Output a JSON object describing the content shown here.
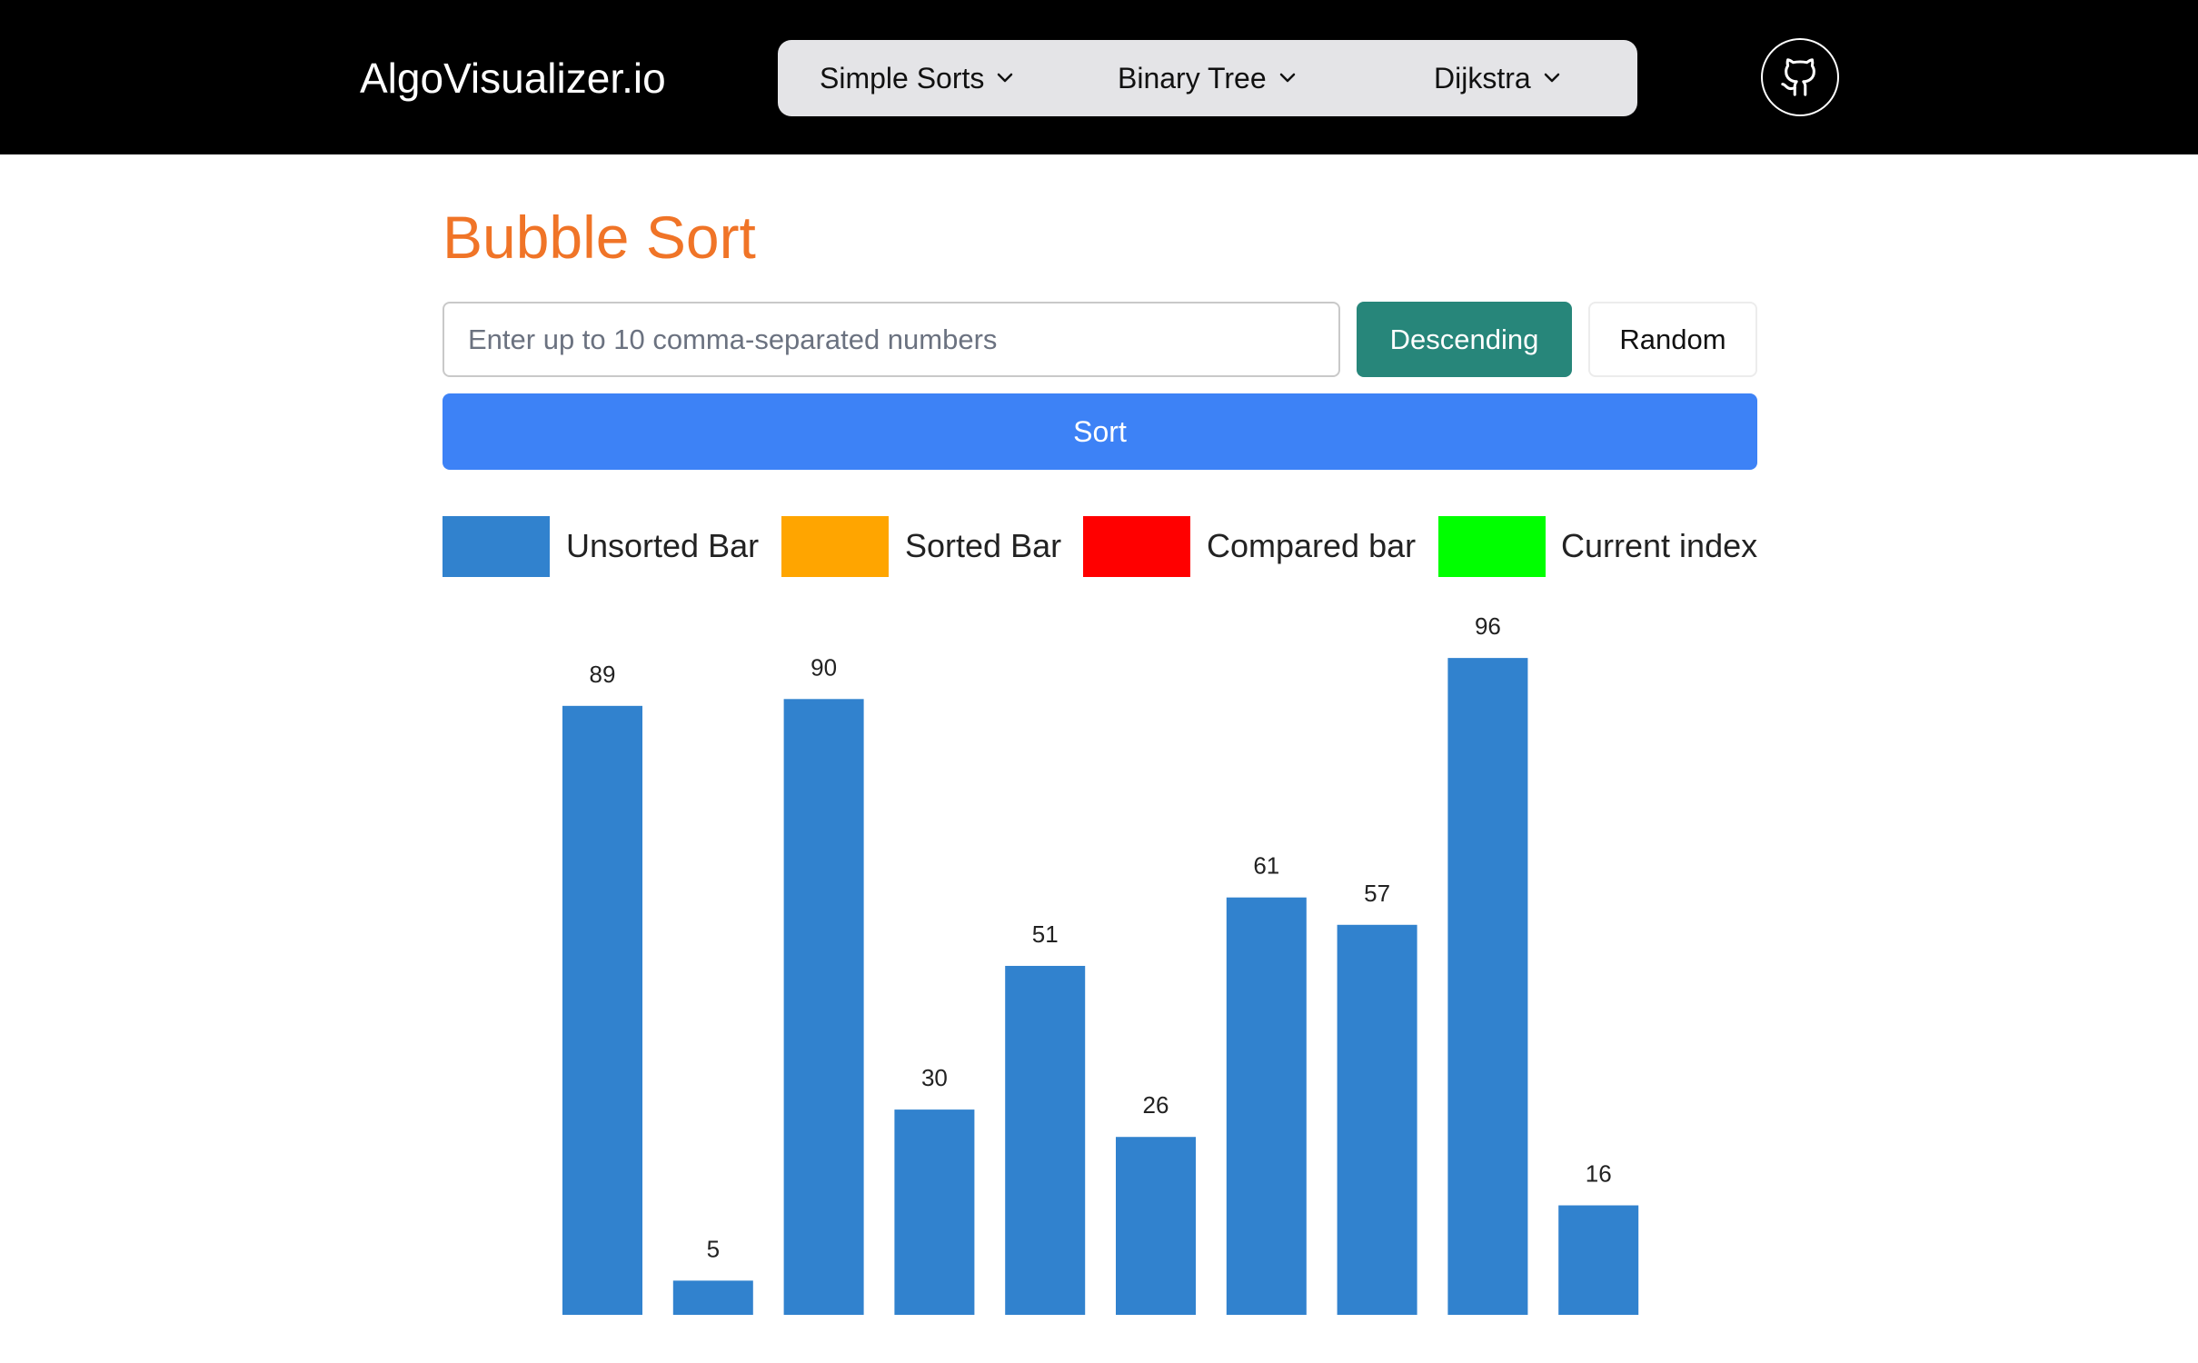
{
  "navbar": {
    "brand": "AlgoVisualizer.io",
    "menu": [
      {
        "label": "Simple Sorts"
      },
      {
        "label": "Binary Tree"
      },
      {
        "label": "Dijkstra"
      }
    ],
    "github_icon": "github-icon"
  },
  "page": {
    "title": "Bubble Sort"
  },
  "input": {
    "placeholder": "Enter up to 10 comma-separated numbers",
    "value": ""
  },
  "buttons": {
    "descending": "Descending",
    "random": "Random",
    "sort": "Sort"
  },
  "legend": [
    {
      "label": "Unsorted Bar",
      "color": "#3182ce"
    },
    {
      "label": "Sorted Bar",
      "color": "#ffa500"
    },
    {
      "label": "Compared bar",
      "color": "#ff0000"
    },
    {
      "label": "Current index",
      "color": "#00ff00"
    }
  ],
  "colors": {
    "accent": "#f07427",
    "descending_bg": "#27867a",
    "sort_bg": "#3d82f6",
    "bar": "#3182ce"
  },
  "chart_data": {
    "type": "bar",
    "values": [
      89,
      5,
      90,
      30,
      51,
      26,
      61,
      57,
      96,
      16
    ],
    "color": "#3182ce"
  }
}
